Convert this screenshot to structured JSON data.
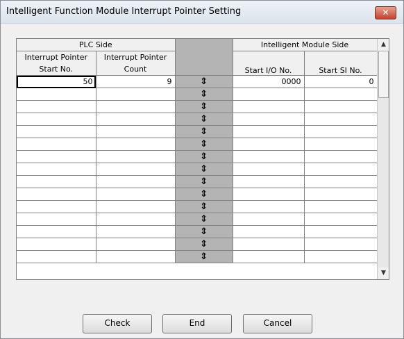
{
  "window": {
    "title": "Intelligent Function Module Interrupt Pointer Setting",
    "close_label": "✕"
  },
  "header": {
    "plc_side": "PLC Side",
    "module_side": "Intelligent Module Side",
    "col_start_no_line1": "Interrupt Pointer",
    "col_start_no_line2": "Start No.",
    "col_count_line1": "Interrupt Pointer",
    "col_count_line2": "Count",
    "col_start_io": "Start I/O No.",
    "col_start_si": "Start SI No."
  },
  "rows": [
    {
      "start_no": "50",
      "count": "9",
      "start_io": "0000",
      "start_si": "0"
    },
    {
      "start_no": "",
      "count": "",
      "start_io": "",
      "start_si": ""
    },
    {
      "start_no": "",
      "count": "",
      "start_io": "",
      "start_si": ""
    },
    {
      "start_no": "",
      "count": "",
      "start_io": "",
      "start_si": ""
    },
    {
      "start_no": "",
      "count": "",
      "start_io": "",
      "start_si": ""
    },
    {
      "start_no": "",
      "count": "",
      "start_io": "",
      "start_si": ""
    },
    {
      "start_no": "",
      "count": "",
      "start_io": "",
      "start_si": ""
    },
    {
      "start_no": "",
      "count": "",
      "start_io": "",
      "start_si": ""
    },
    {
      "start_no": "",
      "count": "",
      "start_io": "",
      "start_si": ""
    },
    {
      "start_no": "",
      "count": "",
      "start_io": "",
      "start_si": ""
    },
    {
      "start_no": "",
      "count": "",
      "start_io": "",
      "start_si": ""
    },
    {
      "start_no": "",
      "count": "",
      "start_io": "",
      "start_si": ""
    },
    {
      "start_no": "",
      "count": "",
      "start_io": "",
      "start_si": ""
    },
    {
      "start_no": "",
      "count": "",
      "start_io": "",
      "start_si": ""
    },
    {
      "start_no": "",
      "count": "",
      "start_io": "",
      "start_si": ""
    }
  ],
  "icons": {
    "connector": "double-arrow-connector-icon",
    "scroll_up": "scroll-up-arrow-icon",
    "scroll_down": "scroll-down-arrow-icon"
  },
  "buttons": {
    "check": "Check",
    "end": "End",
    "cancel": "Cancel"
  }
}
